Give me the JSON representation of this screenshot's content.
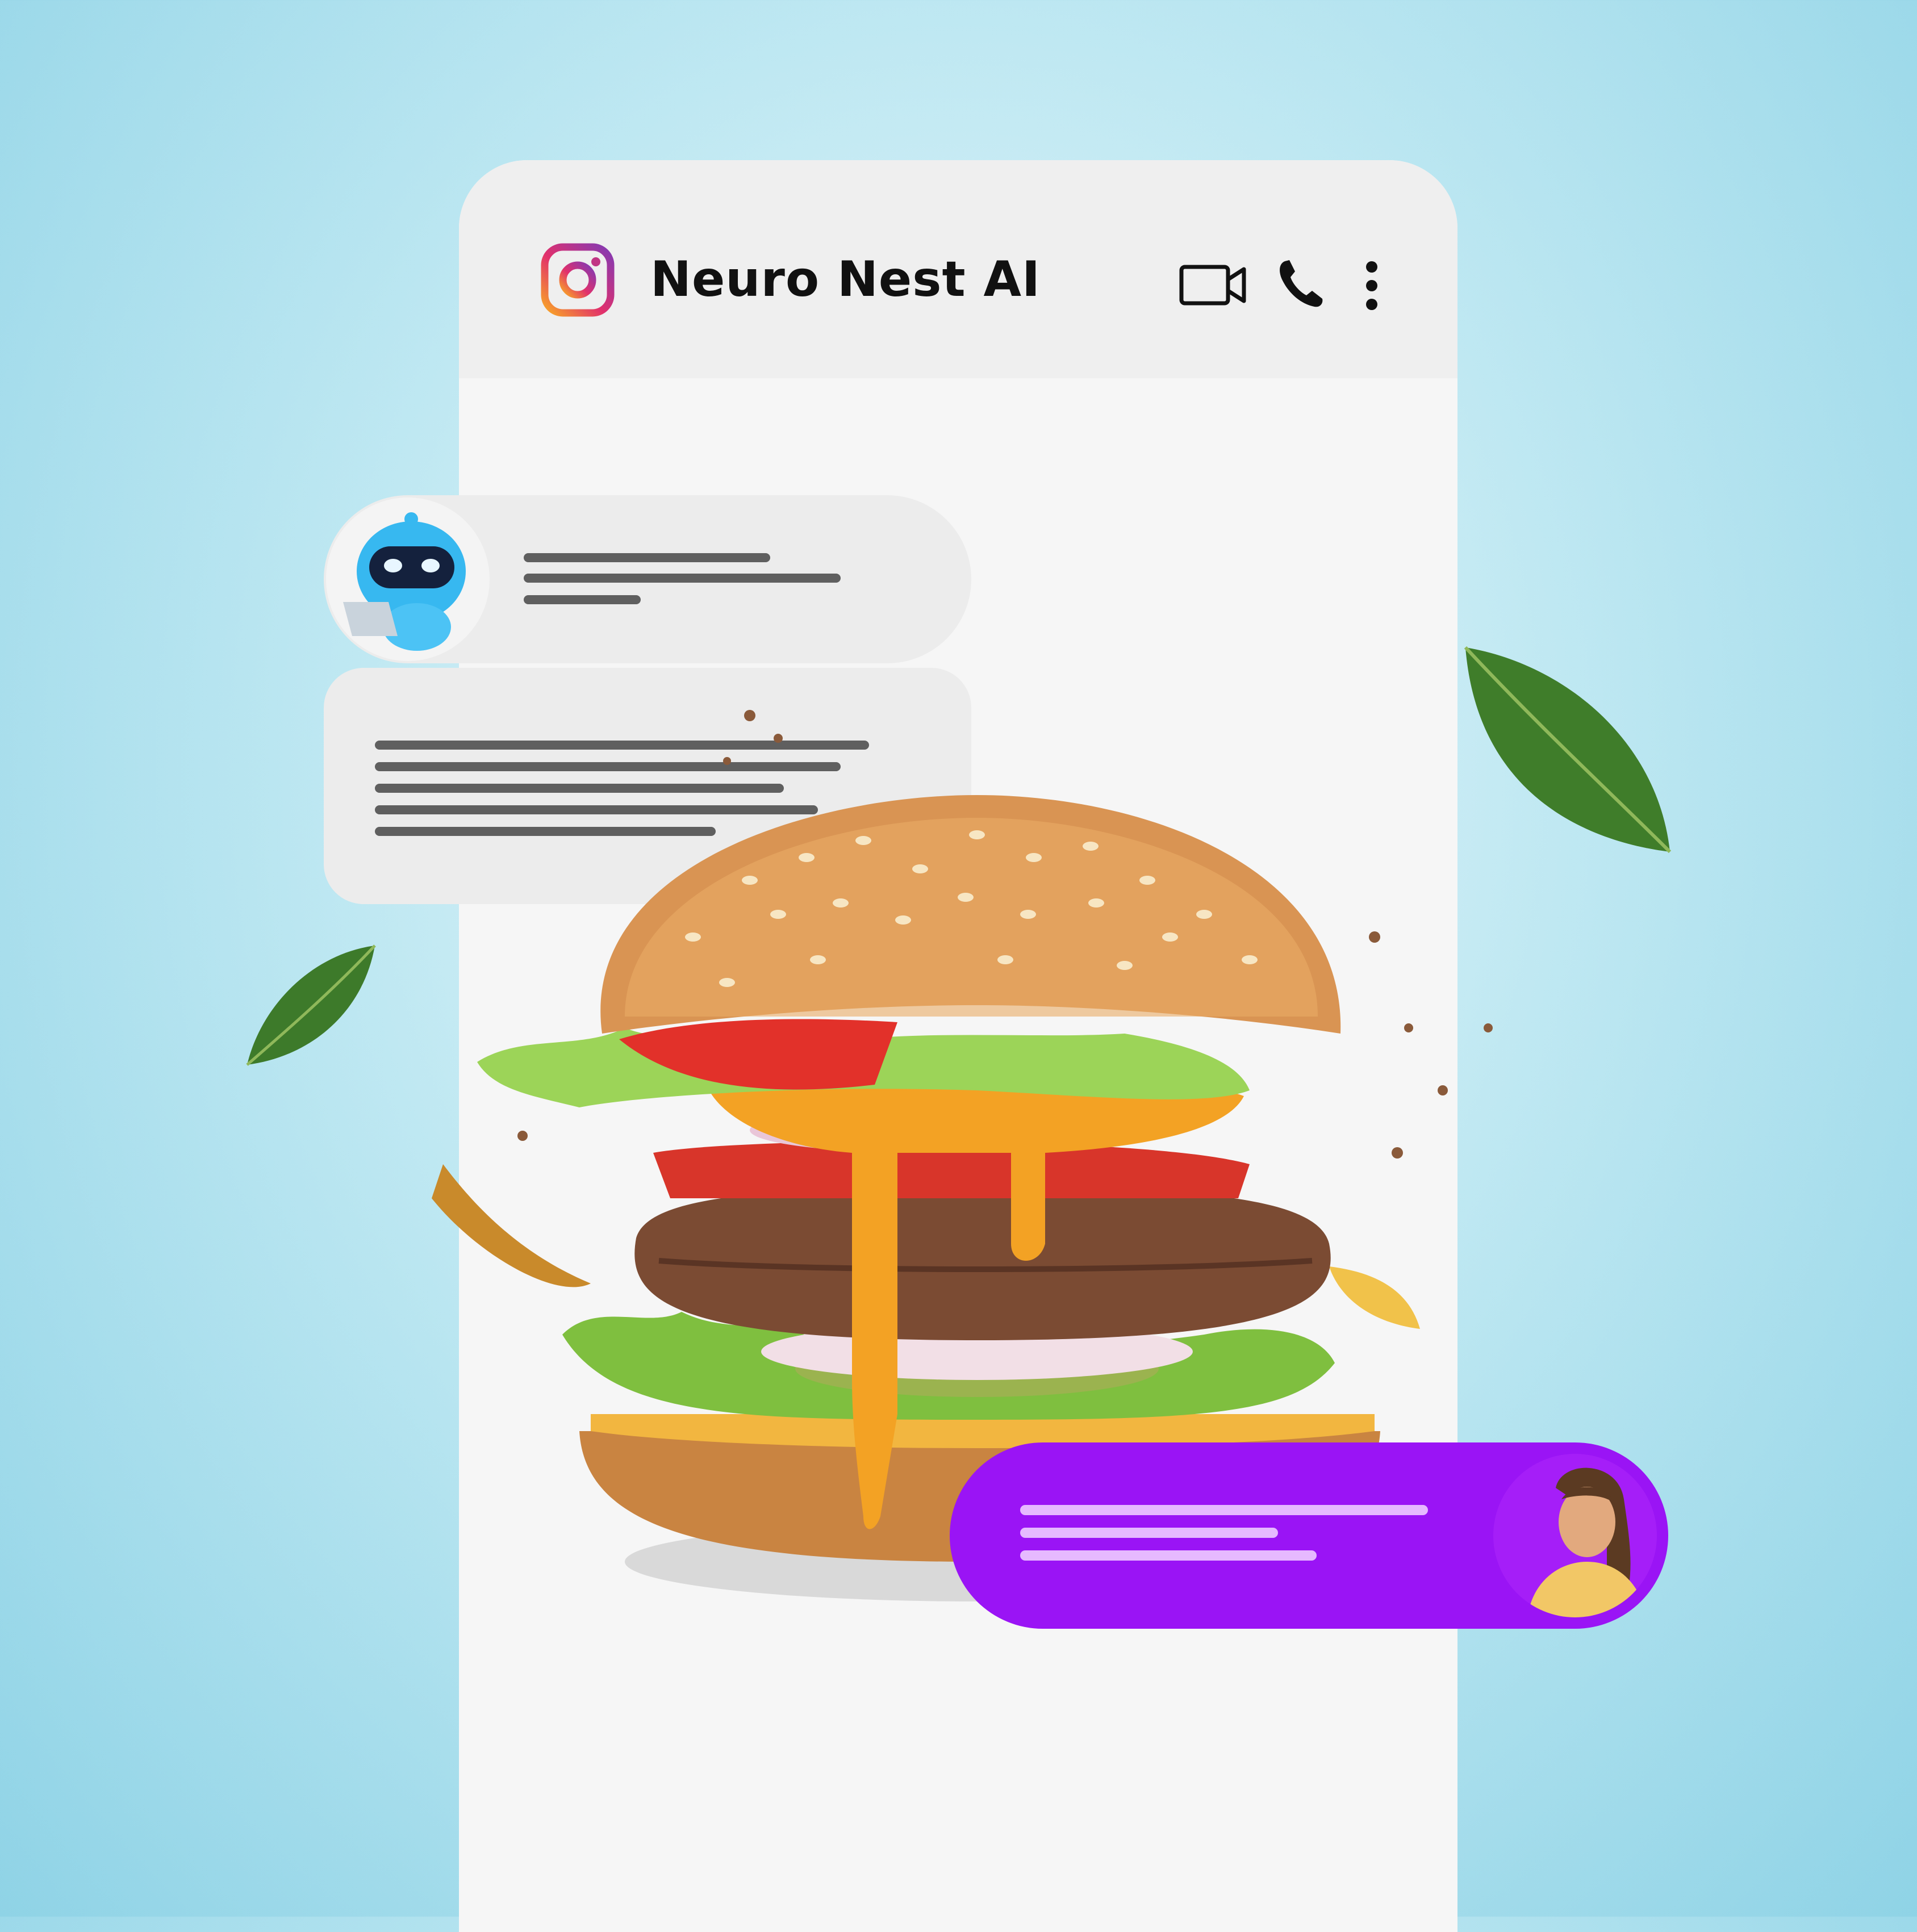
{
  "header": {
    "app_icon": "instagram-icon",
    "title": "Neuro Nest AI",
    "actions": [
      {
        "icon": "video-camera-icon"
      },
      {
        "icon": "phone-icon"
      },
      {
        "icon": "more-vertical-icon"
      }
    ]
  },
  "messages": [
    {
      "sender": "bot",
      "avatar": "robot-avatar"
    },
    {
      "sender": "bot"
    },
    {
      "sender": "user",
      "avatar": "user-avatar"
    }
  ],
  "colors": {
    "background": "#bfe8f2",
    "phone": "#f6f6f6",
    "header": "#efefef",
    "bot_bubble": "#ececec",
    "user_bubble": "#9a14f5"
  }
}
